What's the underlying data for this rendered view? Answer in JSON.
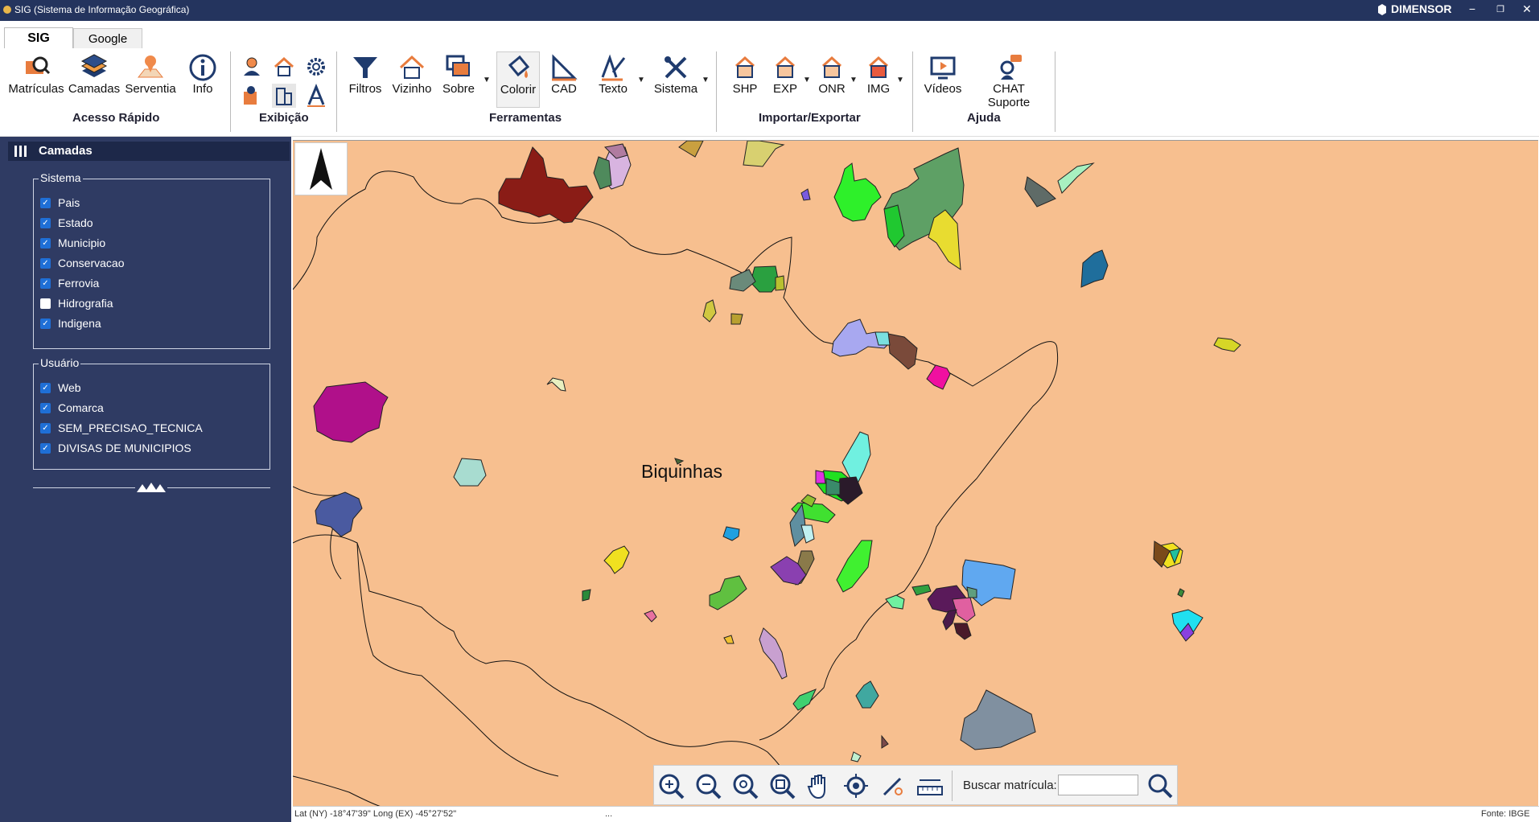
{
  "window": {
    "title": "SIG (Sistema de Informação Geográfica)",
    "brand": "DIMENSOR",
    "minimize": "−",
    "restore": "❐",
    "close": "✕"
  },
  "tabs": [
    {
      "label": "SIG"
    },
    {
      "label": "Google"
    }
  ],
  "ribbon": {
    "buttons": {
      "matriculas": "Matrículas",
      "camadas": "Camadas",
      "serventia": "Serventia",
      "info": "Info",
      "filtros": "Filtros",
      "vizinho": "Vizinho",
      "sobre": "Sobre",
      "colorir": "Colorir",
      "cad": "CAD",
      "texto": "Texto",
      "sistema": "Sistema",
      "shp": "SHP",
      "exp": "EXP",
      "onr": "ONR",
      "img": "IMG",
      "videos": "Vídeos",
      "chat": "CHAT Suporte"
    },
    "groups": {
      "acesso": "Acesso Rápido",
      "exibicao": "Exibição",
      "ferramentas": "Ferramentas",
      "importar": "Importar/Exportar",
      "ajuda": "Ajuda"
    }
  },
  "sidebar": {
    "title": "Camadas",
    "sistema": {
      "legend": "Sistema",
      "items": [
        {
          "label": "Pais",
          "checked": true
        },
        {
          "label": "Estado",
          "checked": true
        },
        {
          "label": "Municipio",
          "checked": true
        },
        {
          "label": "Conservacao",
          "checked": true
        },
        {
          "label": "Ferrovia",
          "checked": true
        },
        {
          "label": "Hidrografia",
          "checked": false
        },
        {
          "label": "Indigena",
          "checked": true
        }
      ]
    },
    "usuario": {
      "legend": "Usuário",
      "items": [
        {
          "label": "Web",
          "checked": true
        },
        {
          "label": "Comarca",
          "checked": true
        },
        {
          "label": "SEM_PRECISAO_TECNICA",
          "checked": true
        },
        {
          "label": "DIVISAS DE MUNICIPIOS",
          "checked": true
        }
      ]
    }
  },
  "map": {
    "place_label": "Biquinhas",
    "background": "#f7bf8f"
  },
  "map_tools": {
    "search_label": "Buscar matrícula:",
    "search_value": ""
  },
  "status": {
    "coords": "Lat (NY) -18°47'39\" Long (EX) -45°27'52\"",
    "middle": "...",
    "source": "Fonte: IBGE"
  }
}
